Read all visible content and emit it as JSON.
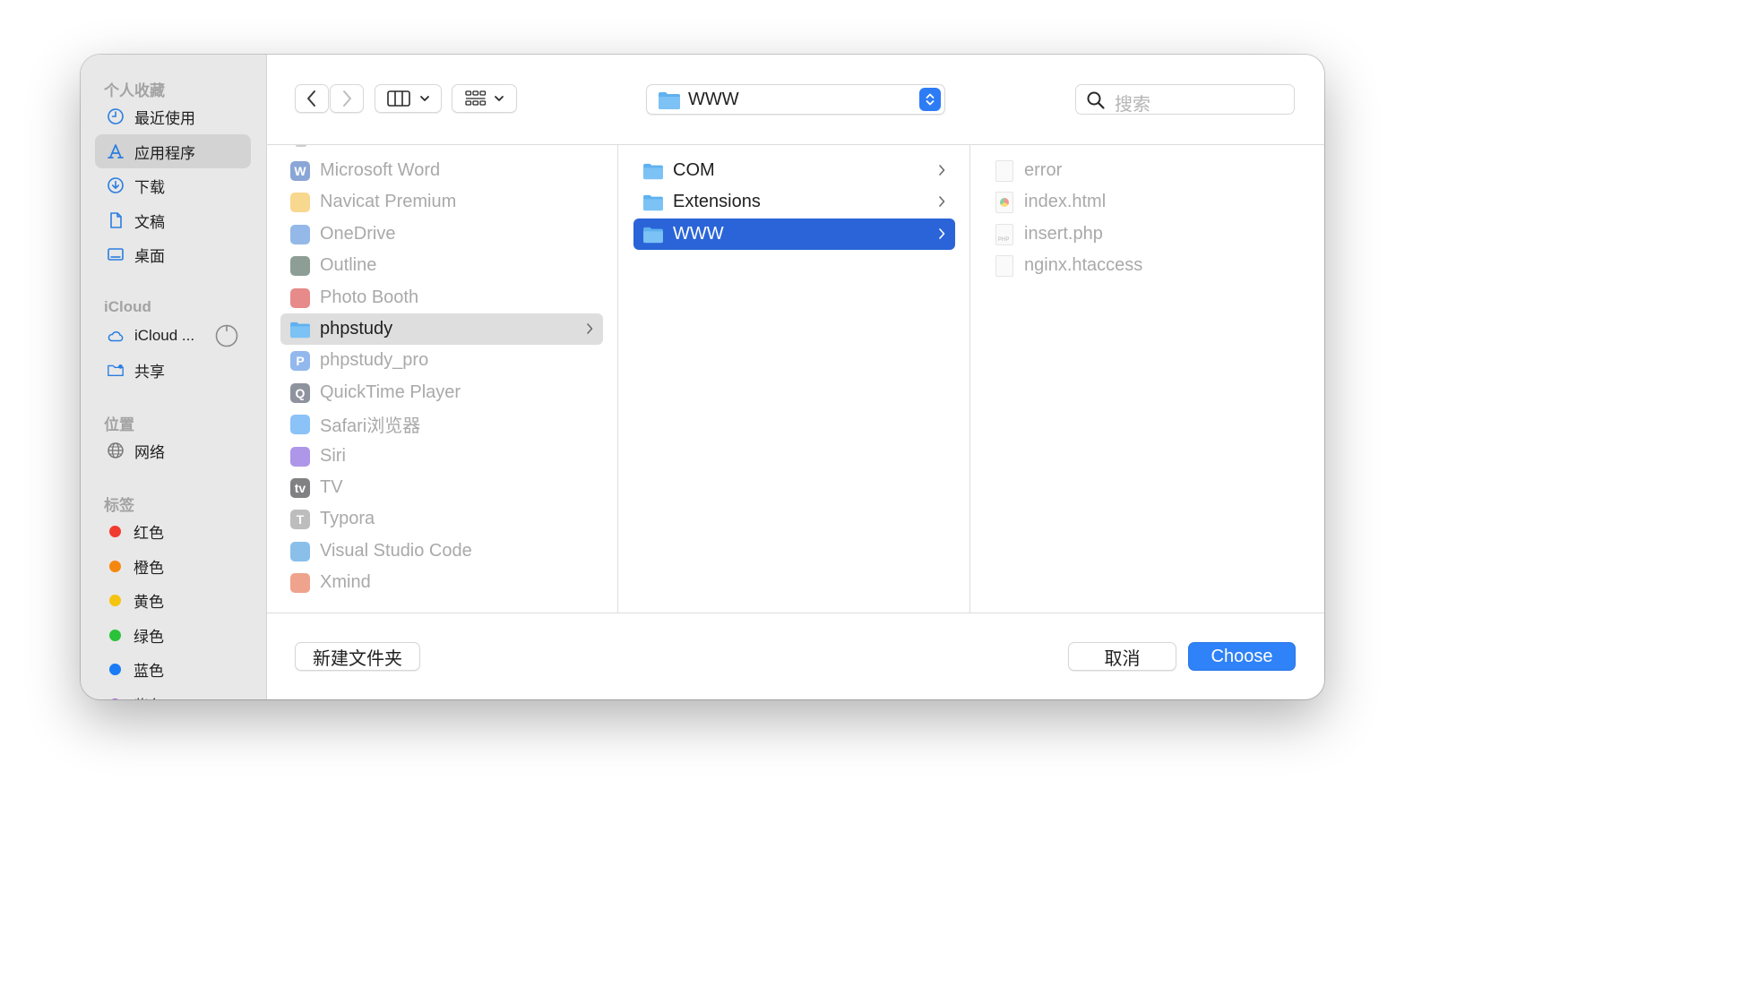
{
  "sidebar": {
    "favorites_header": "个人收藏",
    "favorites": [
      {
        "label": "最近使用"
      },
      {
        "label": "应用程序"
      },
      {
        "label": "下载"
      },
      {
        "label": "文稿"
      },
      {
        "label": "桌面"
      }
    ],
    "icloud_header": "iCloud",
    "icloud": [
      {
        "label": "iCloud ..."
      },
      {
        "label": "共享"
      }
    ],
    "locations_header": "位置",
    "locations": [
      {
        "label": "网络"
      }
    ],
    "tags_header": "标签",
    "tags": [
      {
        "label": "红色",
        "color": "#f23b30"
      },
      {
        "label": "橙色",
        "color": "#f5870f"
      },
      {
        "label": "黄色",
        "color": "#f5c40f"
      },
      {
        "label": "绿色",
        "color": "#2ac23a"
      },
      {
        "label": "蓝色",
        "color": "#1a7bf5"
      },
      {
        "label": "紫色",
        "color": "#a55be0"
      }
    ]
  },
  "toolbar": {
    "path_label": "WWW",
    "search_placeholder": "搜索"
  },
  "columns": {
    "applications": [
      {
        "label": "Microsoft Word",
        "icon": "word-icon",
        "color": "#2b5eb6"
      },
      {
        "label": "Navicat Premium",
        "icon": "navicat-icon",
        "color": "#f2b632"
      },
      {
        "label": "OneDrive",
        "icon": "onedrive-icon",
        "color": "#3d7fd6"
      },
      {
        "label": "Outline",
        "icon": "outline-icon",
        "color": "#2f4f3f"
      },
      {
        "label": "Photo Booth",
        "icon": "photobooth-icon",
        "color": "#d32a2a"
      },
      {
        "label": "phpstudy",
        "icon": "folder-icon",
        "color": "#5aa9ea"
      },
      {
        "label": "phpstudy_pro",
        "icon": "phpstudy-icon",
        "color": "#3b7fe0"
      },
      {
        "label": "QuickTime Player",
        "icon": "quicktime-icon",
        "color": "#333b4f"
      },
      {
        "label": "Safari浏览器",
        "icon": "safari-icon",
        "color": "#2b8ff0"
      },
      {
        "label": "Siri",
        "icon": "siri-icon",
        "color": "#6b3fd6"
      },
      {
        "label": "TV",
        "icon": "tv-icon",
        "color": "#1c1c1e"
      },
      {
        "label": "Typora",
        "icon": "typora-icon",
        "color": "#888888"
      },
      {
        "label": "Visual Studio Code",
        "icon": "vscode-icon",
        "color": "#2a8ad8"
      },
      {
        "label": "Xmind",
        "icon": "xmind-icon",
        "color": "#e2582e"
      }
    ],
    "phpstudy": [
      {
        "label": "COM"
      },
      {
        "label": "Extensions"
      },
      {
        "label": "WWW"
      }
    ],
    "www": [
      {
        "label": "error",
        "icon": "file-icon"
      },
      {
        "label": "index.html",
        "icon": "html-file-icon"
      },
      {
        "label": "insert.php",
        "icon": "php-file-icon"
      },
      {
        "label": "nginx.htaccess",
        "icon": "file-icon"
      }
    ]
  },
  "footer": {
    "new_folder": "新建文件夹",
    "cancel": "取消",
    "choose": "Choose"
  }
}
